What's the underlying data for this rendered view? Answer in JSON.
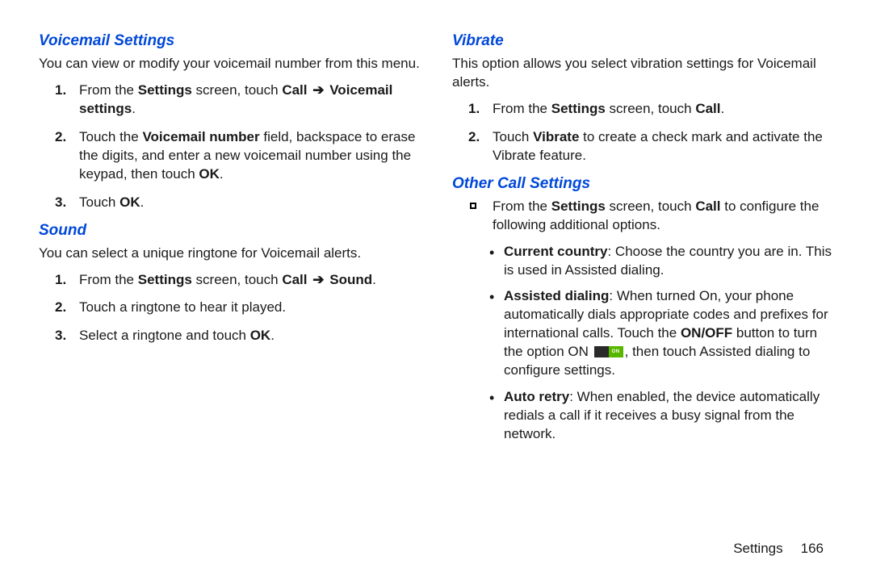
{
  "left": {
    "h1": "Voicemail Settings",
    "p1": "You can view or modify your voicemail number from this menu.",
    "s1_a": "From the ",
    "s1_b": "Settings",
    "s1_c": " screen, touch ",
    "s1_d": "Call",
    "s1_e": "Voicemail settings",
    "s1_f": ".",
    "s2_a": "Touch the ",
    "s2_b": "Voicemail number",
    "s2_c": " field, backspace to erase the digits, and enter a new voicemail number using the keypad, then touch ",
    "s2_d": "OK",
    "s2_e": ".",
    "s3_a": "Touch ",
    "s3_b": "OK",
    "s3_c": ".",
    "h2": "Sound",
    "p2": "You can select a unique ringtone for Voicemail alerts.",
    "ss1_a": "From the ",
    "ss1_b": "Settings",
    "ss1_c": " screen, touch ",
    "ss1_d": "Call",
    "ss1_e": "Sound",
    "ss1_f": ".",
    "ss2": "Touch a ringtone to hear it played.",
    "ss3_a": " Select a ringtone and touch ",
    "ss3_b": "OK",
    "ss3_c": "."
  },
  "right": {
    "h1": "Vibrate",
    "p1": "This option allows you select vibration settings for Voicemail alerts.",
    "v1_a": "From the ",
    "v1_b": "Settings",
    "v1_c": " screen, touch ",
    "v1_d": "Call",
    "v1_e": ".",
    "v2_a": "Touch ",
    "v2_b": "Vibrate",
    "v2_c": " to create a check mark and activate the Vibrate feature.",
    "h2": "Other Call Settings",
    "o1_a": "From the ",
    "o1_b": "Settings",
    "o1_c": " screen, touch ",
    "o1_d": "Call",
    "o1_e": " to configure the following additional options.",
    "b1_a": "Current country",
    "b1_b": ": Choose the country you are in. This is used in Assisted dialing.",
    "b2_a": "Assisted dialing",
    "b2_b": ": When turned On, your phone automatically dials appropriate codes and prefixes for international calls. Touch the ",
    "b2_c": "ON/OFF",
    "b2_d": " button to turn the option ON ",
    "b2_e": ", then touch Assisted dialing to configure settings.",
    "b3_a": "Auto retry",
    "b3_b": ": When enabled, the device automatically redials a call if it receives a busy signal from the network.",
    "toggle_on": "ON"
  },
  "arrow": "➔",
  "footer_label": "Settings",
  "page_number": "166"
}
